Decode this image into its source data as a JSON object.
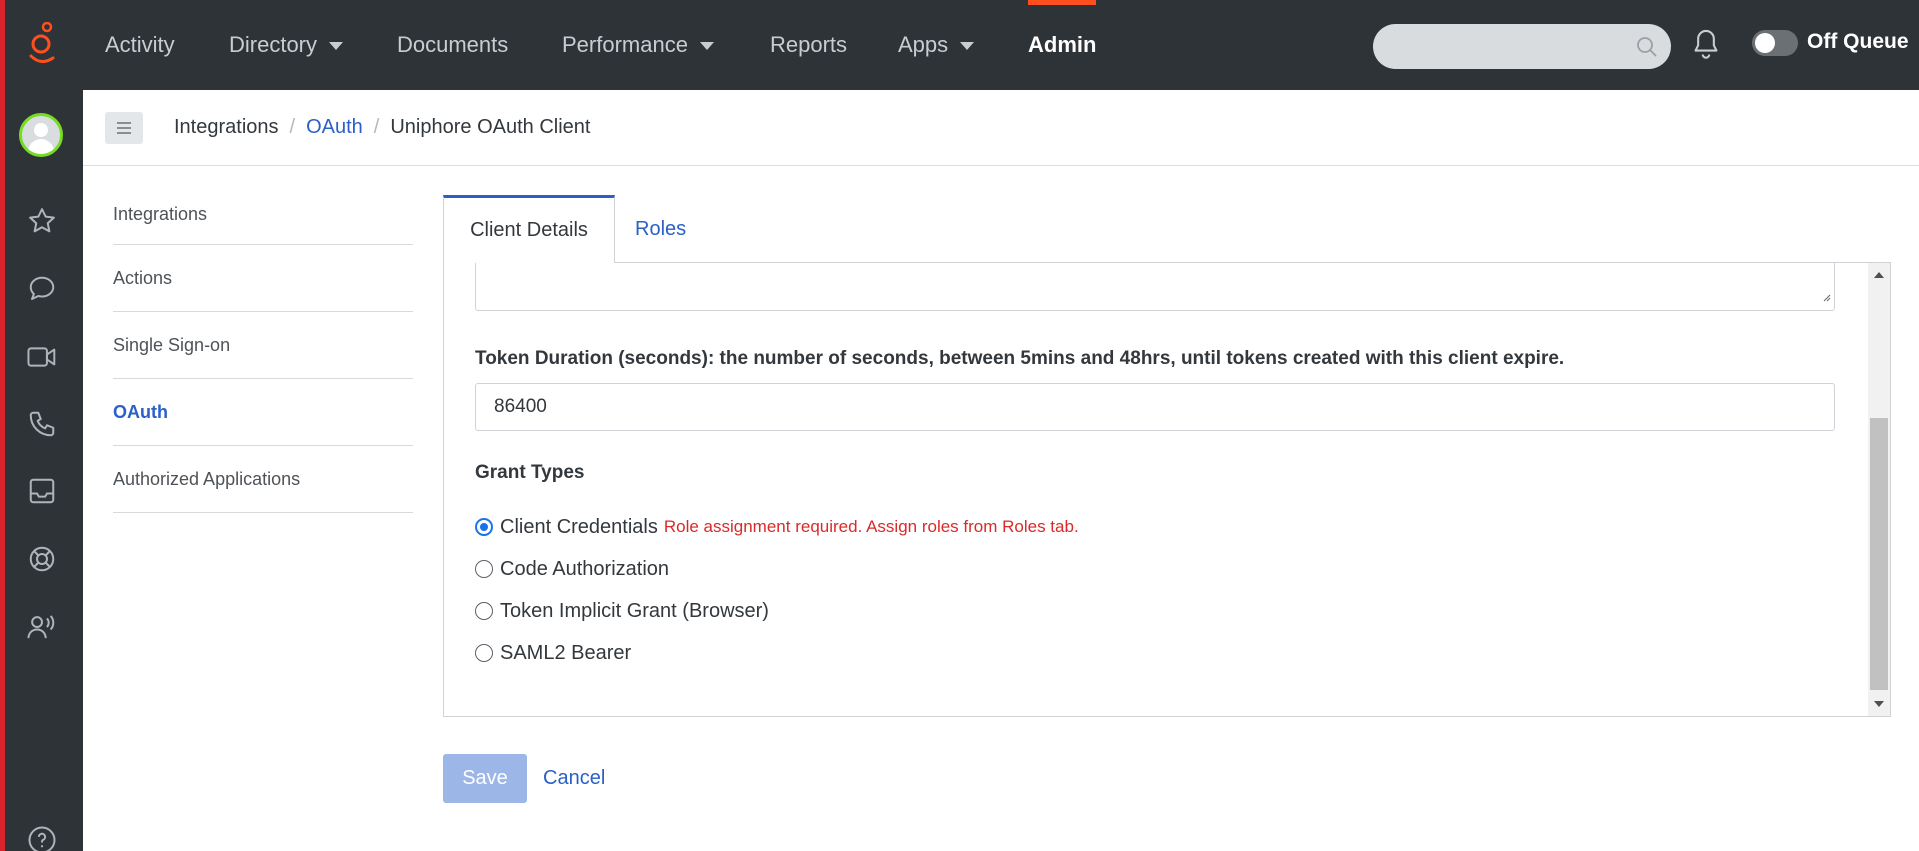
{
  "topnav": {
    "items": [
      {
        "label": "Activity"
      },
      {
        "label": "Directory"
      },
      {
        "label": "Documents"
      },
      {
        "label": "Performance"
      },
      {
        "label": "Reports"
      },
      {
        "label": "Apps"
      },
      {
        "label": "Admin"
      }
    ],
    "search_placeholder": "",
    "queue_status": "Off Queue"
  },
  "breadcrumb": {
    "items": [
      "Integrations",
      "OAuth",
      "Uniphore OAuth Client"
    ]
  },
  "subnav": {
    "items": [
      {
        "label": "Integrations"
      },
      {
        "label": "Actions"
      },
      {
        "label": "Single Sign-on"
      },
      {
        "label": "OAuth"
      },
      {
        "label": "Authorized Applications"
      }
    ]
  },
  "tabs": [
    {
      "label": "Client Details"
    },
    {
      "label": "Roles"
    }
  ],
  "form": {
    "token_label": "Token Duration (seconds): the number of seconds, between 5mins and 48hrs, until tokens created with this client expire.",
    "token_value": "86400",
    "grant_types_label": "Grant Types",
    "grant_options": [
      {
        "label": "Client Credentials",
        "selected": true
      },
      {
        "label": "Code Authorization",
        "selected": false
      },
      {
        "label": "Token Implicit Grant (Browser)",
        "selected": false
      },
      {
        "label": "SAML2 Bearer",
        "selected": false
      }
    ],
    "role_warning": "Role assignment required. Assign roles from Roles tab."
  },
  "actions": {
    "save_label": "Save",
    "cancel_label": "Cancel"
  },
  "colors": {
    "topbar": "#2e3338",
    "accent": "#ff4f1f",
    "link": "#2a60c8",
    "warning": "#d92a2a",
    "save_disabled": "#9db6e8"
  }
}
